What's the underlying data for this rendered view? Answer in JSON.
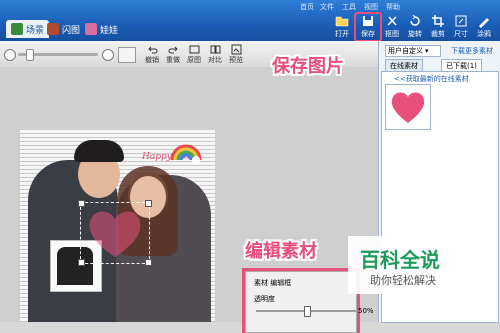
{
  "header": {
    "tabs": [
      {
        "label": "场景",
        "color": "#3a8c3a"
      },
      {
        "label": "闪图",
        "color": "#b04a2a"
      },
      {
        "label": "娃娃",
        "color": "#d66fa0"
      }
    ],
    "menu": [
      "首页",
      "文件",
      "工具",
      "视图",
      "帮助"
    ],
    "toolbar": [
      {
        "label": "打开",
        "icon": "folder-icon"
      },
      {
        "label": "保存",
        "icon": "save-icon"
      },
      {
        "label": "抠图",
        "icon": "cutout-icon"
      },
      {
        "label": "旋转",
        "icon": "rotate-icon"
      },
      {
        "label": "裁剪",
        "icon": "crop-icon"
      },
      {
        "label": "尺寸",
        "icon": "resize-icon"
      },
      {
        "label": "涂鸦",
        "icon": "doodle-icon"
      }
    ]
  },
  "subtoolbar": {
    "buttons": [
      {
        "label": "撤销"
      },
      {
        "label": "重做"
      },
      {
        "label": "原图"
      },
      {
        "label": "对比"
      },
      {
        "label": "预览"
      }
    ]
  },
  "annotations": {
    "save_image": "保存图片",
    "edit_material": "编辑素材"
  },
  "right_panel": {
    "custom_label": "用户自定义",
    "download_more": "下载更多素材",
    "tab_online": "在线素材",
    "tab_downloaded": "已下载(1)",
    "get_latest": "<<获取最新的在线素材"
  },
  "editor_panel": {
    "title": "素材 编辑框",
    "opacity_label": "透明度",
    "opacity_value": "50%"
  },
  "photo": {
    "sticker_text": "Happy Love"
  },
  "watermark": {
    "title": "百科全说",
    "subtitle": "助你轻松解决"
  },
  "colors": {
    "accent_pink": "#e8507b",
    "title_bar": "#1b5eb8"
  }
}
